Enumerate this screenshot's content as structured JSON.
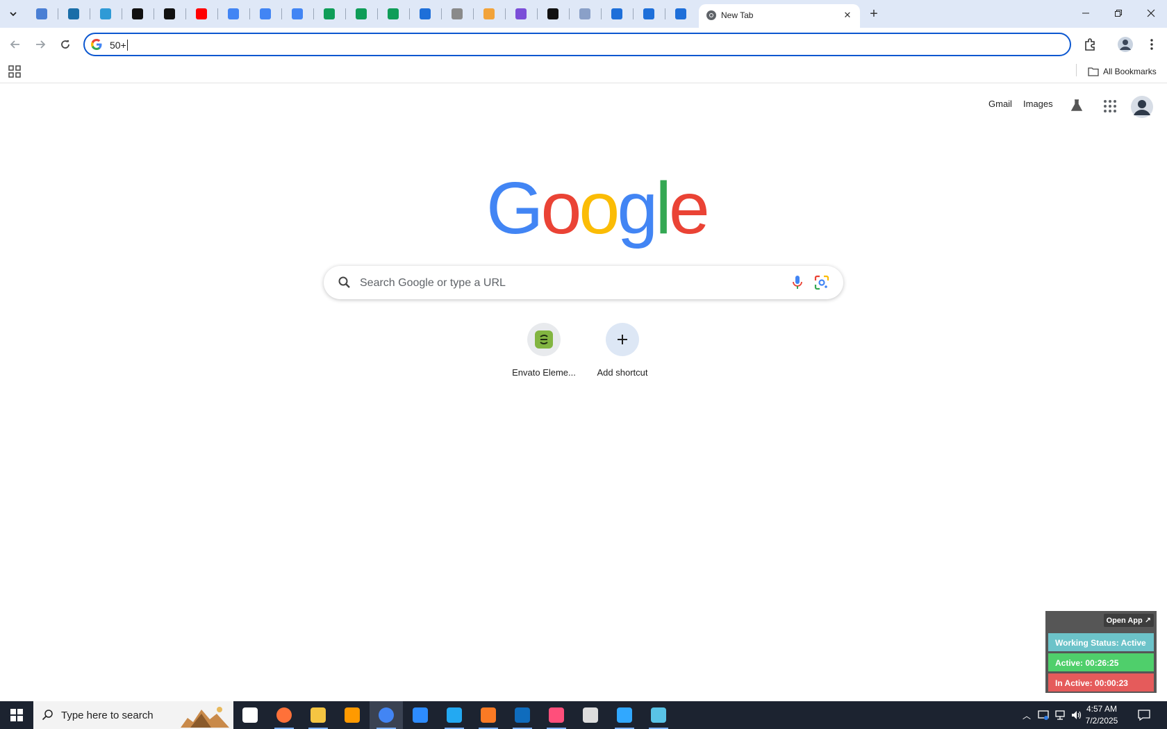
{
  "tabs": {
    "active_title": "New Tab",
    "pinned": [
      {
        "icon": "globe-blue-icon",
        "color": "#4a7fd4"
      },
      {
        "icon": "vpn-shield-icon",
        "color": "#1a6ea8"
      },
      {
        "icon": "hex-app-icon",
        "color": "#2f9ad6"
      },
      {
        "icon": "openai-icon",
        "color": "#111111"
      },
      {
        "icon": "bolt-app-icon",
        "color": "#111111"
      },
      {
        "icon": "youtube-icon",
        "color": "#ff0000"
      },
      {
        "icon": "google-docs-icon",
        "color": "#4285f4"
      },
      {
        "icon": "google-docs-icon",
        "color": "#4285f4"
      },
      {
        "icon": "google-docs-icon",
        "color": "#4285f4"
      },
      {
        "icon": "google-sheets-icon",
        "color": "#0f9d58"
      },
      {
        "icon": "google-sheets-icon",
        "color": "#0f9d58"
      },
      {
        "icon": "google-sheets-icon",
        "color": "#0f9d58"
      },
      {
        "icon": "mailchimp-app-icon",
        "color": "#1e6fd9"
      },
      {
        "icon": "globe-gray-icon",
        "color": "#8a8a8a"
      },
      {
        "icon": "fox-app-icon",
        "color": "#f2a33a"
      },
      {
        "icon": "code-braces-icon",
        "color": "#7b4ed8"
      },
      {
        "icon": "letter-a-app-icon",
        "color": "#111111"
      },
      {
        "icon": "qr-app-icon",
        "color": "#8aa0c8"
      },
      {
        "icon": "google-forms-icon",
        "color": "#1e6fd9"
      },
      {
        "icon": "google-forms-icon",
        "color": "#1e6fd9"
      },
      {
        "icon": "google-forms-icon",
        "color": "#1e6fd9"
      }
    ]
  },
  "omnibox": {
    "value": "50+"
  },
  "bookmarks": {
    "all_label": "All Bookmarks"
  },
  "ntp": {
    "gmail": "Gmail",
    "images": "Images",
    "search_placeholder": "Search Google or type a URL",
    "logo_letters": [
      "G",
      "o",
      "o",
      "g",
      "l",
      "e"
    ],
    "logo_colors": [
      "#4285f4",
      "#ea4335",
      "#fbbc05",
      "#4285f4",
      "#34a853",
      "#ea4335"
    ],
    "shortcuts": [
      {
        "label": "Envato Eleme...",
        "icon": "envato-icon"
      },
      {
        "label": "Add shortcut",
        "icon": "plus-icon"
      }
    ]
  },
  "widget": {
    "open_app": "Open App ↗",
    "working_status": "Working Status: Active",
    "active": "Active: 00:26:25",
    "inactive": "In Active: 00:00:23",
    "colors": {
      "status": "#6cc3c9",
      "active": "#4fcf6b",
      "inactive": "#e55b5b"
    }
  },
  "taskbar": {
    "search_placeholder": "Type here to search",
    "time": "4:57 AM",
    "date": "7/2/2025",
    "apps": [
      "task-view-icon",
      "firefox-icon",
      "file-explorer-icon",
      "illustrator-icon",
      "chrome-icon",
      "zoom-icon",
      "vscode-icon",
      "xampp-icon",
      "outlook-icon",
      "creative-cloud-icon",
      "pen-tool-icon",
      "photoshop-icon",
      "hex-app-icon"
    ]
  }
}
